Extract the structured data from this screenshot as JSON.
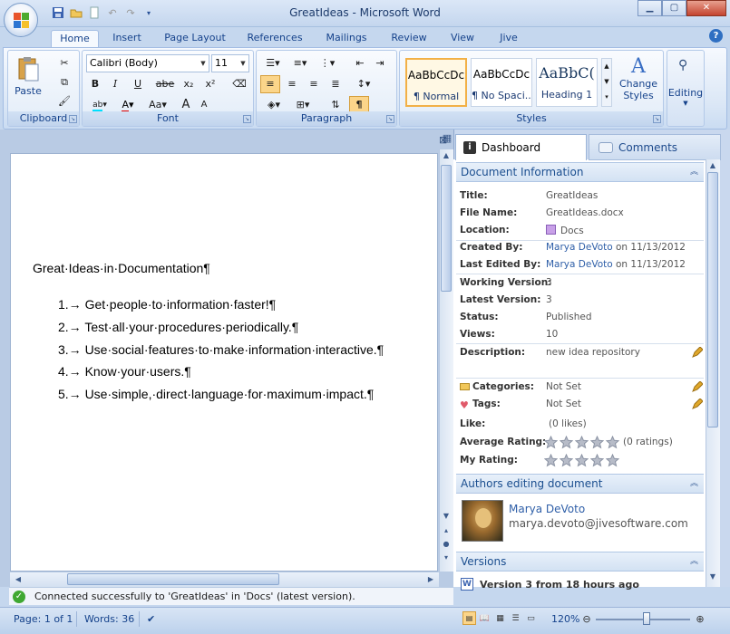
{
  "window": {
    "title": "GreatIdeas - Microsoft Word"
  },
  "ribbon_tabs": [
    "Home",
    "Insert",
    "Page Layout",
    "References",
    "Mailings",
    "Review",
    "View",
    "Jive"
  ],
  "ribbon": {
    "clipboard": {
      "label": "Clipboard",
      "paste": "Paste"
    },
    "font": {
      "label": "Font",
      "name": "Calibri (Body)",
      "size": "11",
      "bold": "B",
      "italic": "I",
      "underline": "U",
      "strike": "abe",
      "sub": "x₂",
      "sup": "x²",
      "grow": "A",
      "shrink": "A",
      "case": "Aa"
    },
    "paragraph": {
      "label": "Paragraph",
      "show": "¶"
    },
    "styles": {
      "label": "Styles",
      "items": [
        {
          "sample": "AaBbCcDc",
          "name": "¶ Normal"
        },
        {
          "sample": "AaBbCcDc",
          "name": "¶ No Spaci..."
        },
        {
          "sample": "AaBbC(",
          "name": "Heading 1"
        }
      ],
      "change": "Change",
      "change2": "Styles"
    },
    "editing": {
      "label": "Editing"
    }
  },
  "document": {
    "heading": "Great·Ideas·in·Documentation¶",
    "items": [
      "1.→ Get·people·to·information·faster!¶",
      "2.→ Test·all·your·procedures·periodically.¶",
      "3.→ Use·social·features·to·make·information·interactive.¶",
      "4.→ Know·your·users.¶",
      "5.→ Use·simple,·direct·language·for·maximum·impact.¶"
    ]
  },
  "pane": {
    "tabs": {
      "dashboard": "Dashboard",
      "comments": "Comments"
    },
    "doc_info": {
      "header": "Document Information",
      "title_label": "Title:",
      "title": "GreatIdeas",
      "filename_label": "File Name:",
      "filename": "GreatIdeas.docx",
      "location_label": "Location:",
      "location": "Docs",
      "created_label": "Created By:",
      "created_by": "Marya DeVoto",
      "created_on": "on 11/13/2012",
      "edited_label": "Last Edited By:",
      "edited_by": "Marya DeVoto",
      "edited_on": "on 11/13/2012",
      "working_label": "Working Version:",
      "working": "3",
      "latest_label": "Latest Version:",
      "latest": "3",
      "status_label": "Status:",
      "status": "Published",
      "views_label": "Views:",
      "views": "10",
      "desc_label": "Description:",
      "description": "new idea repository",
      "categories_label": "Categories:",
      "categories": "Not Set",
      "tags_label": "Tags:",
      "tags": "Not Set",
      "like_label": "Like:",
      "likes": "(0 likes)",
      "avg_label": "Average Rating:",
      "avg_rating": "(0 ratings)",
      "my_label": "My Rating:"
    },
    "authors": {
      "header": "Authors editing document",
      "name": "Marya DeVoto",
      "email": "marya.devoto@jivesoftware.com"
    },
    "versions": {
      "header": "Versions",
      "item": "Version 3 from 18 hours ago"
    }
  },
  "connection": {
    "message": "Connected successfully to 'GreatIdeas' in 'Docs' (latest version)."
  },
  "status": {
    "page": "Page: 1 of 1",
    "words": "Words: 36",
    "zoom": "120%"
  },
  "colors": {
    "accent": "#15428b",
    "ribbon_bg": "#dbe7f6",
    "highlight": "#f2b046"
  }
}
